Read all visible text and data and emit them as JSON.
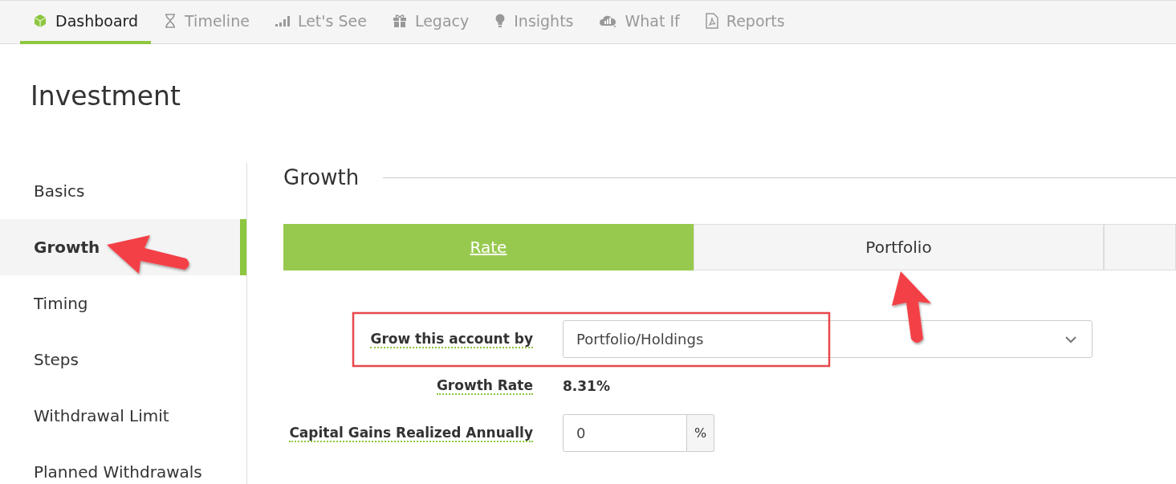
{
  "nav": [
    {
      "label": "Dashboard",
      "selected": true
    },
    {
      "label": "Timeline",
      "selected": false
    },
    {
      "label": "Let's See",
      "selected": false
    },
    {
      "label": "Legacy",
      "selected": false
    },
    {
      "label": "Insights",
      "selected": false
    },
    {
      "label": "What If",
      "selected": false
    },
    {
      "label": "Reports",
      "selected": false
    }
  ],
  "page_title": "Investment",
  "sidebar": {
    "items": [
      {
        "label": "Basics",
        "selected": false
      },
      {
        "label": "Growth",
        "selected": true
      },
      {
        "label": "Timing",
        "selected": false
      },
      {
        "label": "Steps",
        "selected": false
      },
      {
        "label": "Withdrawal Limit",
        "selected": false
      },
      {
        "label": "Planned Withdrawals",
        "selected": false
      }
    ]
  },
  "section_title": "Growth",
  "segments": [
    {
      "label": "Rate",
      "selected": true
    },
    {
      "label": "Portfolio",
      "selected": false
    }
  ],
  "form": {
    "grow_by": {
      "label": "Grow this account by",
      "value": "Portfolio/Holdings"
    },
    "growth_rate": {
      "label": "Growth Rate",
      "value": "8.31%"
    },
    "capital_gains": {
      "label": "Capital Gains Realized Annually",
      "value": "0",
      "unit": "%"
    }
  }
}
